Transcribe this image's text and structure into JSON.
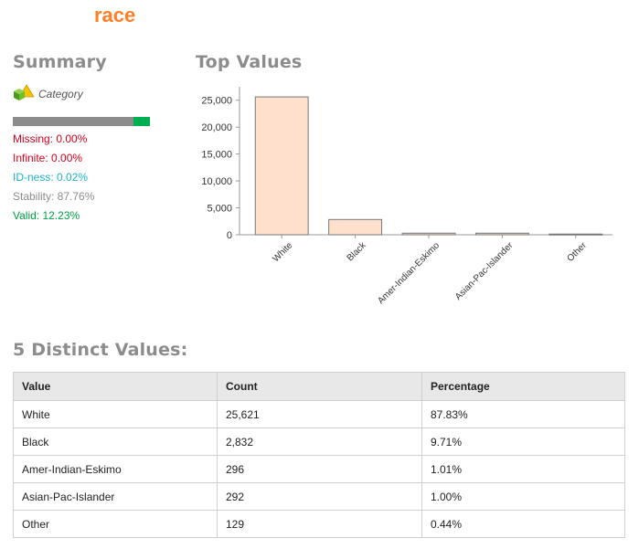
{
  "header": {
    "title": "race"
  },
  "summary": {
    "heading": "Summary",
    "type_label": "Category",
    "valid_fraction": 0.1223,
    "colors": {
      "bar_base": "#8c8c8c",
      "bar_fill": "#00b050"
    },
    "stats": {
      "missing": "Missing: 0.00%",
      "infinite": "Infinite: 0.00%",
      "idness": "ID-ness: 0.02%",
      "stability": "Stability: 87.76%",
      "valid": "Valid: 12.23%"
    }
  },
  "top_values": {
    "heading": "Top Values"
  },
  "chart_data": {
    "type": "bar",
    "categories": [
      "White",
      "Black",
      "Amer-Indian-Eskimo",
      "Asian-Pac-Islander",
      "Other"
    ],
    "values": [
      25621,
      2832,
      296,
      292,
      129
    ],
    "yticks": [
      "0",
      "5,000",
      "10,000",
      "15,000",
      "20,000",
      "25,000"
    ],
    "ylim": [
      0,
      27500
    ],
    "bar_color": "#ffe0cc",
    "bar_stroke": "#777777",
    "grid": false
  },
  "distinct": {
    "heading": "5 Distinct Values:",
    "columns": [
      "Value",
      "Count",
      "Percentage"
    ],
    "rows": [
      [
        "White",
        "25,621",
        "87.83%"
      ],
      [
        "Black",
        "2,832",
        "9.71%"
      ],
      [
        "Amer-Indian-Eskimo",
        "296",
        "1.01%"
      ],
      [
        "Asian-Pac-Islander",
        "292",
        "1.00%"
      ],
      [
        "Other",
        "129",
        "0.44%"
      ]
    ]
  }
}
